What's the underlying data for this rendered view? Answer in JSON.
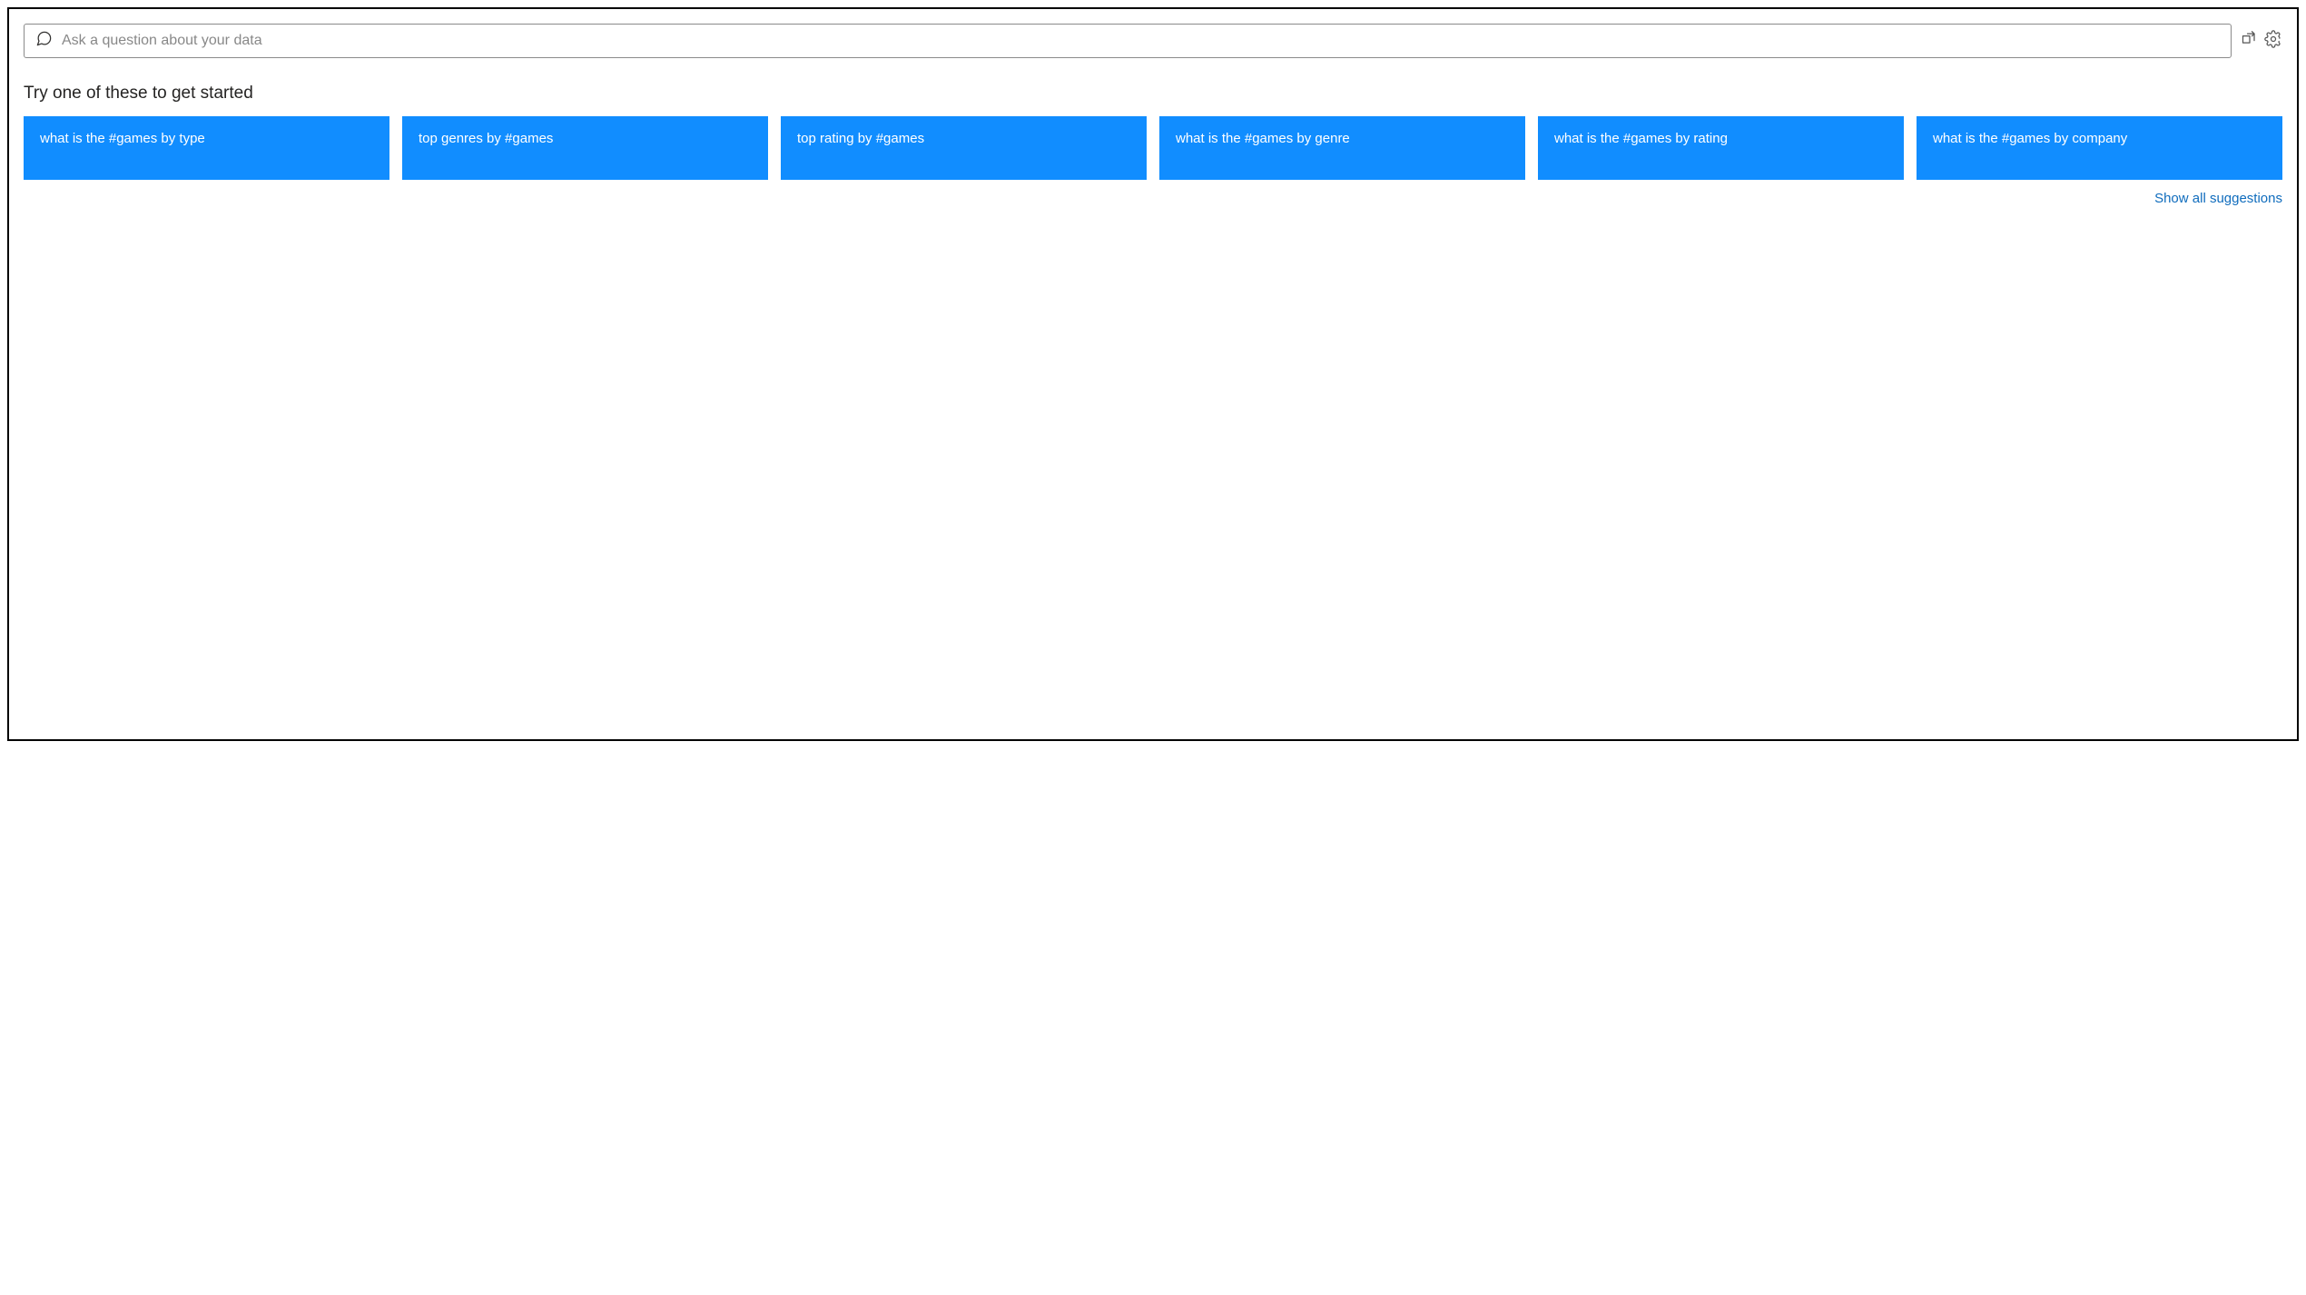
{
  "search": {
    "placeholder": "Ask a question about your data"
  },
  "section_title": "Try one of these to get started",
  "cards": [
    "what is the #games by type",
    "top genres by #games",
    "top rating by #games",
    "what is the #games by genre",
    "what is the #games by rating",
    "what is the #games by company"
  ],
  "show_all_label": "Show all suggestions"
}
